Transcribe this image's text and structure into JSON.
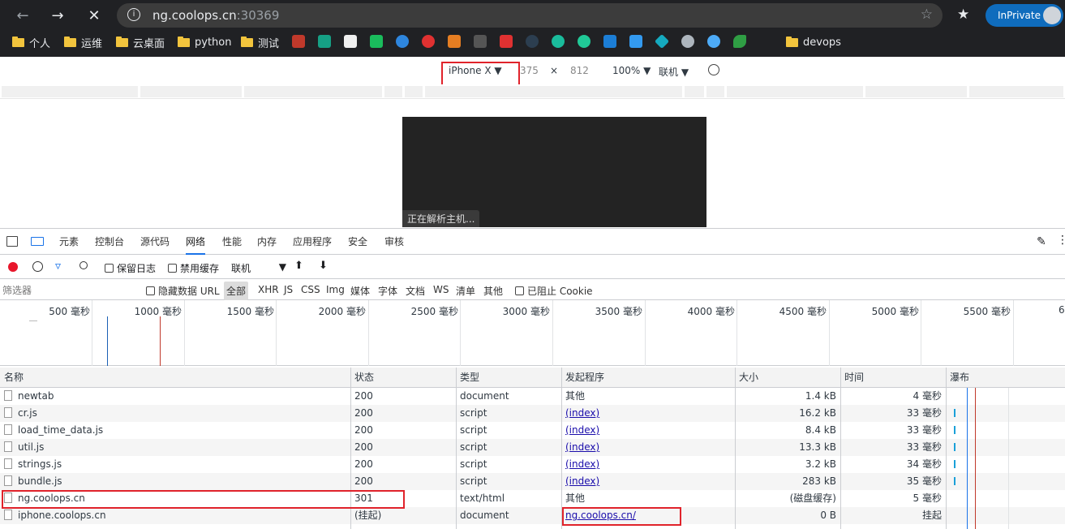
{
  "browser": {
    "url_host": "ng.coolops.cn",
    "url_port": ":30369",
    "inprivate_label": "InPrivate",
    "bookmarks": [
      {
        "label": "个人",
        "type": "folder"
      },
      {
        "label": "运维",
        "type": "folder"
      },
      {
        "label": "云桌面",
        "type": "folder"
      },
      {
        "label": "python",
        "type": "folder"
      },
      {
        "label": "测试",
        "type": "folder"
      },
      {
        "label": "devops",
        "type": "folder"
      }
    ]
  },
  "device_toolbar": {
    "device": "iPhone X",
    "width": "375",
    "times": "×",
    "height": "812",
    "zoom": "100%",
    "throttle": "联机"
  },
  "page_status": "正在解析主机...",
  "devtools": {
    "tabs": [
      "元素",
      "控制台",
      "源代码",
      "网络",
      "性能",
      "内存",
      "应用程序",
      "安全",
      "审核"
    ],
    "active_tab": "网络",
    "toolbar": {
      "preserve_log": "保留日志",
      "disable_cache": "禁用缓存",
      "throttle": "联机"
    },
    "filter": {
      "placeholder": "筛选器",
      "hide_data_urls": "隐藏数据 URL",
      "types": [
        "全部",
        "XHR",
        "JS",
        "CSS",
        "Img",
        "媒体",
        "字体",
        "文档",
        "WS",
        "清单",
        "其他"
      ],
      "blocked_cookies": "已阻止 Cookie"
    },
    "timeline_ticks": [
      "500 毫秒",
      "1000 毫秒",
      "1500 毫秒",
      "2000 毫秒",
      "2500 毫秒",
      "3000 毫秒",
      "3500 毫秒",
      "4000 毫秒",
      "4500 毫秒",
      "5000 毫秒",
      "5500 毫秒",
      "6"
    ],
    "columns": [
      "名称",
      "状态",
      "类型",
      "发起程序",
      "大小",
      "时间",
      "瀑布"
    ],
    "rows": [
      {
        "name": "newtab",
        "status": "200",
        "type": "document",
        "initiator": "其他",
        "initiator_link": false,
        "size": "1.4 kB",
        "time": "4 毫秒"
      },
      {
        "name": "cr.js",
        "status": "200",
        "type": "script",
        "initiator": "(index)",
        "initiator_link": true,
        "size": "16.2 kB",
        "time": "33 毫秒"
      },
      {
        "name": "load_time_data.js",
        "status": "200",
        "type": "script",
        "initiator": "(index)",
        "initiator_link": true,
        "size": "8.4 kB",
        "time": "33 毫秒"
      },
      {
        "name": "util.js",
        "status": "200",
        "type": "script",
        "initiator": "(index)",
        "initiator_link": true,
        "size": "13.3 kB",
        "time": "33 毫秒"
      },
      {
        "name": "strings.js",
        "status": "200",
        "type": "script",
        "initiator": "(index)",
        "initiator_link": true,
        "size": "3.2 kB",
        "time": "34 毫秒"
      },
      {
        "name": "bundle.js",
        "status": "200",
        "type": "script",
        "initiator": "(index)",
        "initiator_link": true,
        "size": "283 kB",
        "time": "35 毫秒"
      },
      {
        "name": "ng.coolops.cn",
        "status": "301",
        "type": "text/html",
        "initiator": "其他",
        "initiator_link": false,
        "size": "(磁盘缓存)",
        "time": "5 毫秒"
      },
      {
        "name": "iphone.coolops.cn",
        "status": "(挂起)",
        "type": "document",
        "initiator": "ng.coolops.cn/",
        "initiator_link": true,
        "size": "0 B",
        "time": "挂起"
      }
    ]
  }
}
